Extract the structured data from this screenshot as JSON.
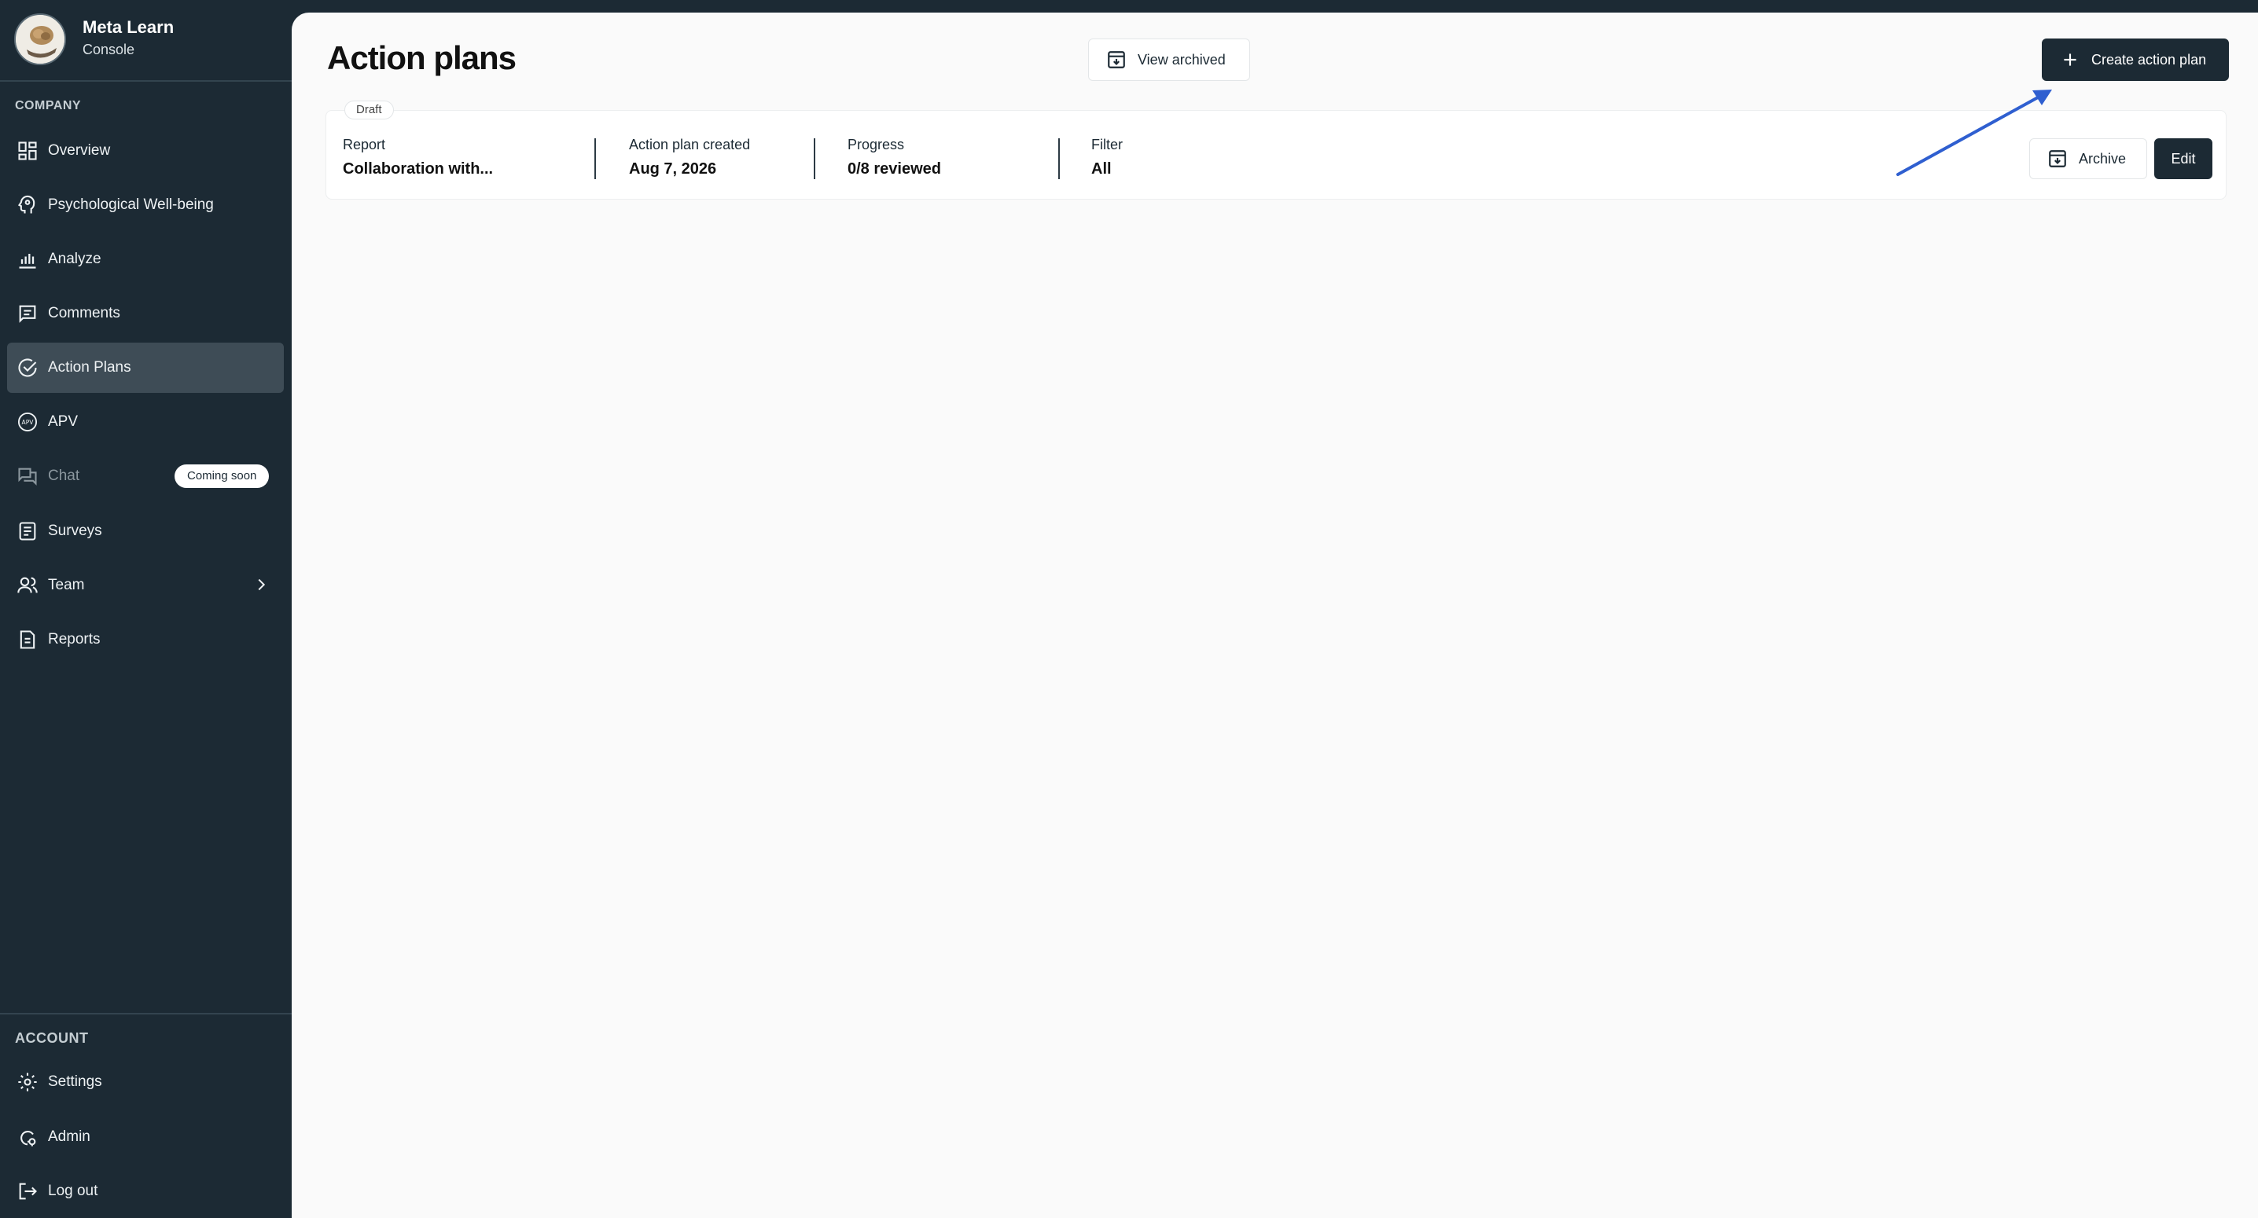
{
  "brand": {
    "name": "Meta Learn",
    "subtitle": "Console"
  },
  "sidebar": {
    "company_title": "COMPANY",
    "items": [
      {
        "label": "Overview",
        "icon": "grid-icon"
      },
      {
        "label": "Psychological Well-being",
        "icon": "head-icon"
      },
      {
        "label": "Analyze",
        "icon": "bar-chart-icon"
      },
      {
        "label": "Comments",
        "icon": "comment-icon"
      },
      {
        "label": "Action Plans",
        "icon": "check-circle-icon",
        "active": true
      },
      {
        "label": "APV",
        "icon": "apv-icon"
      },
      {
        "label": "Chat",
        "icon": "chat-icon",
        "disabled": true,
        "badge": "Coming soon"
      },
      {
        "label": "Surveys",
        "icon": "clipboard-icon"
      },
      {
        "label": "Team",
        "icon": "team-icon",
        "has_submenu": true
      },
      {
        "label": "Reports",
        "icon": "document-icon"
      }
    ],
    "account_title": "ACCOUNT",
    "account_items": [
      {
        "label": "Settings",
        "icon": "gear-icon"
      },
      {
        "label": "Admin",
        "icon": "admin-icon"
      },
      {
        "label": "Log out",
        "icon": "logout-icon"
      }
    ]
  },
  "main": {
    "title": "Action plans",
    "view_archived_label": "View archived",
    "create_label": "Create action plan",
    "plan": {
      "status": "Draft",
      "report_label": "Report",
      "report_value": "Collaboration with...",
      "created_label": "Action plan created",
      "created_value": "Aug 7, 2026",
      "progress_label": "Progress",
      "progress_value": "0/8 reviewed",
      "filter_label": "Filter",
      "filter_value": "All",
      "archive_label": "Archive",
      "edit_label": "Edit"
    }
  },
  "colors": {
    "sidebar": "#1c2a34",
    "active_item": "#3e4c56",
    "arrow": "#2f5fd0"
  }
}
